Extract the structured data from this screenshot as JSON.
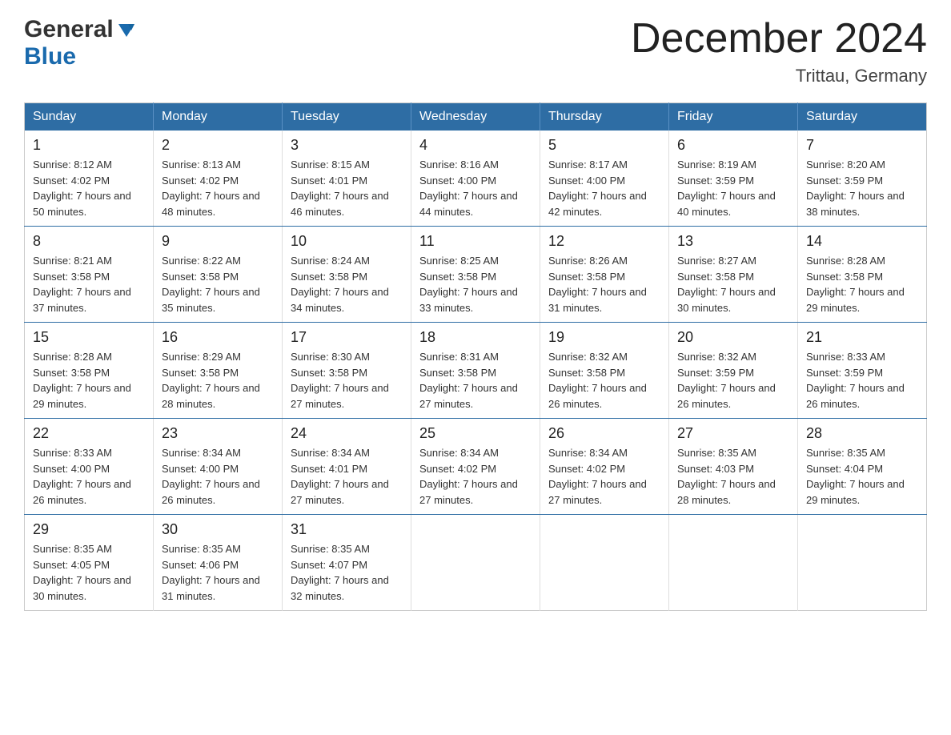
{
  "header": {
    "logo_general": "General",
    "logo_blue": "Blue",
    "month_title": "December 2024",
    "location": "Trittau, Germany"
  },
  "days_of_week": [
    "Sunday",
    "Monday",
    "Tuesday",
    "Wednesday",
    "Thursday",
    "Friday",
    "Saturday"
  ],
  "weeks": [
    [
      {
        "day": "1",
        "sunrise": "8:12 AM",
        "sunset": "4:02 PM",
        "daylight": "7 hours and 50 minutes."
      },
      {
        "day": "2",
        "sunrise": "8:13 AM",
        "sunset": "4:02 PM",
        "daylight": "7 hours and 48 minutes."
      },
      {
        "day": "3",
        "sunrise": "8:15 AM",
        "sunset": "4:01 PM",
        "daylight": "7 hours and 46 minutes."
      },
      {
        "day": "4",
        "sunrise": "8:16 AM",
        "sunset": "4:00 PM",
        "daylight": "7 hours and 44 minutes."
      },
      {
        "day": "5",
        "sunrise": "8:17 AM",
        "sunset": "4:00 PM",
        "daylight": "7 hours and 42 minutes."
      },
      {
        "day": "6",
        "sunrise": "8:19 AM",
        "sunset": "3:59 PM",
        "daylight": "7 hours and 40 minutes."
      },
      {
        "day": "7",
        "sunrise": "8:20 AM",
        "sunset": "3:59 PM",
        "daylight": "7 hours and 38 minutes."
      }
    ],
    [
      {
        "day": "8",
        "sunrise": "8:21 AM",
        "sunset": "3:58 PM",
        "daylight": "7 hours and 37 minutes."
      },
      {
        "day": "9",
        "sunrise": "8:22 AM",
        "sunset": "3:58 PM",
        "daylight": "7 hours and 35 minutes."
      },
      {
        "day": "10",
        "sunrise": "8:24 AM",
        "sunset": "3:58 PM",
        "daylight": "7 hours and 34 minutes."
      },
      {
        "day": "11",
        "sunrise": "8:25 AM",
        "sunset": "3:58 PM",
        "daylight": "7 hours and 33 minutes."
      },
      {
        "day": "12",
        "sunrise": "8:26 AM",
        "sunset": "3:58 PM",
        "daylight": "7 hours and 31 minutes."
      },
      {
        "day": "13",
        "sunrise": "8:27 AM",
        "sunset": "3:58 PM",
        "daylight": "7 hours and 30 minutes."
      },
      {
        "day": "14",
        "sunrise": "8:28 AM",
        "sunset": "3:58 PM",
        "daylight": "7 hours and 29 minutes."
      }
    ],
    [
      {
        "day": "15",
        "sunrise": "8:28 AM",
        "sunset": "3:58 PM",
        "daylight": "7 hours and 29 minutes."
      },
      {
        "day": "16",
        "sunrise": "8:29 AM",
        "sunset": "3:58 PM",
        "daylight": "7 hours and 28 minutes."
      },
      {
        "day": "17",
        "sunrise": "8:30 AM",
        "sunset": "3:58 PM",
        "daylight": "7 hours and 27 minutes."
      },
      {
        "day": "18",
        "sunrise": "8:31 AM",
        "sunset": "3:58 PM",
        "daylight": "7 hours and 27 minutes."
      },
      {
        "day": "19",
        "sunrise": "8:32 AM",
        "sunset": "3:58 PM",
        "daylight": "7 hours and 26 minutes."
      },
      {
        "day": "20",
        "sunrise": "8:32 AM",
        "sunset": "3:59 PM",
        "daylight": "7 hours and 26 minutes."
      },
      {
        "day": "21",
        "sunrise": "8:33 AM",
        "sunset": "3:59 PM",
        "daylight": "7 hours and 26 minutes."
      }
    ],
    [
      {
        "day": "22",
        "sunrise": "8:33 AM",
        "sunset": "4:00 PM",
        "daylight": "7 hours and 26 minutes."
      },
      {
        "day": "23",
        "sunrise": "8:34 AM",
        "sunset": "4:00 PM",
        "daylight": "7 hours and 26 minutes."
      },
      {
        "day": "24",
        "sunrise": "8:34 AM",
        "sunset": "4:01 PM",
        "daylight": "7 hours and 27 minutes."
      },
      {
        "day": "25",
        "sunrise": "8:34 AM",
        "sunset": "4:02 PM",
        "daylight": "7 hours and 27 minutes."
      },
      {
        "day": "26",
        "sunrise": "8:34 AM",
        "sunset": "4:02 PM",
        "daylight": "7 hours and 27 minutes."
      },
      {
        "day": "27",
        "sunrise": "8:35 AM",
        "sunset": "4:03 PM",
        "daylight": "7 hours and 28 minutes."
      },
      {
        "day": "28",
        "sunrise": "8:35 AM",
        "sunset": "4:04 PM",
        "daylight": "7 hours and 29 minutes."
      }
    ],
    [
      {
        "day": "29",
        "sunrise": "8:35 AM",
        "sunset": "4:05 PM",
        "daylight": "7 hours and 30 minutes."
      },
      {
        "day": "30",
        "sunrise": "8:35 AM",
        "sunset": "4:06 PM",
        "daylight": "7 hours and 31 minutes."
      },
      {
        "day": "31",
        "sunrise": "8:35 AM",
        "sunset": "4:07 PM",
        "daylight": "7 hours and 32 minutes."
      },
      null,
      null,
      null,
      null
    ]
  ]
}
